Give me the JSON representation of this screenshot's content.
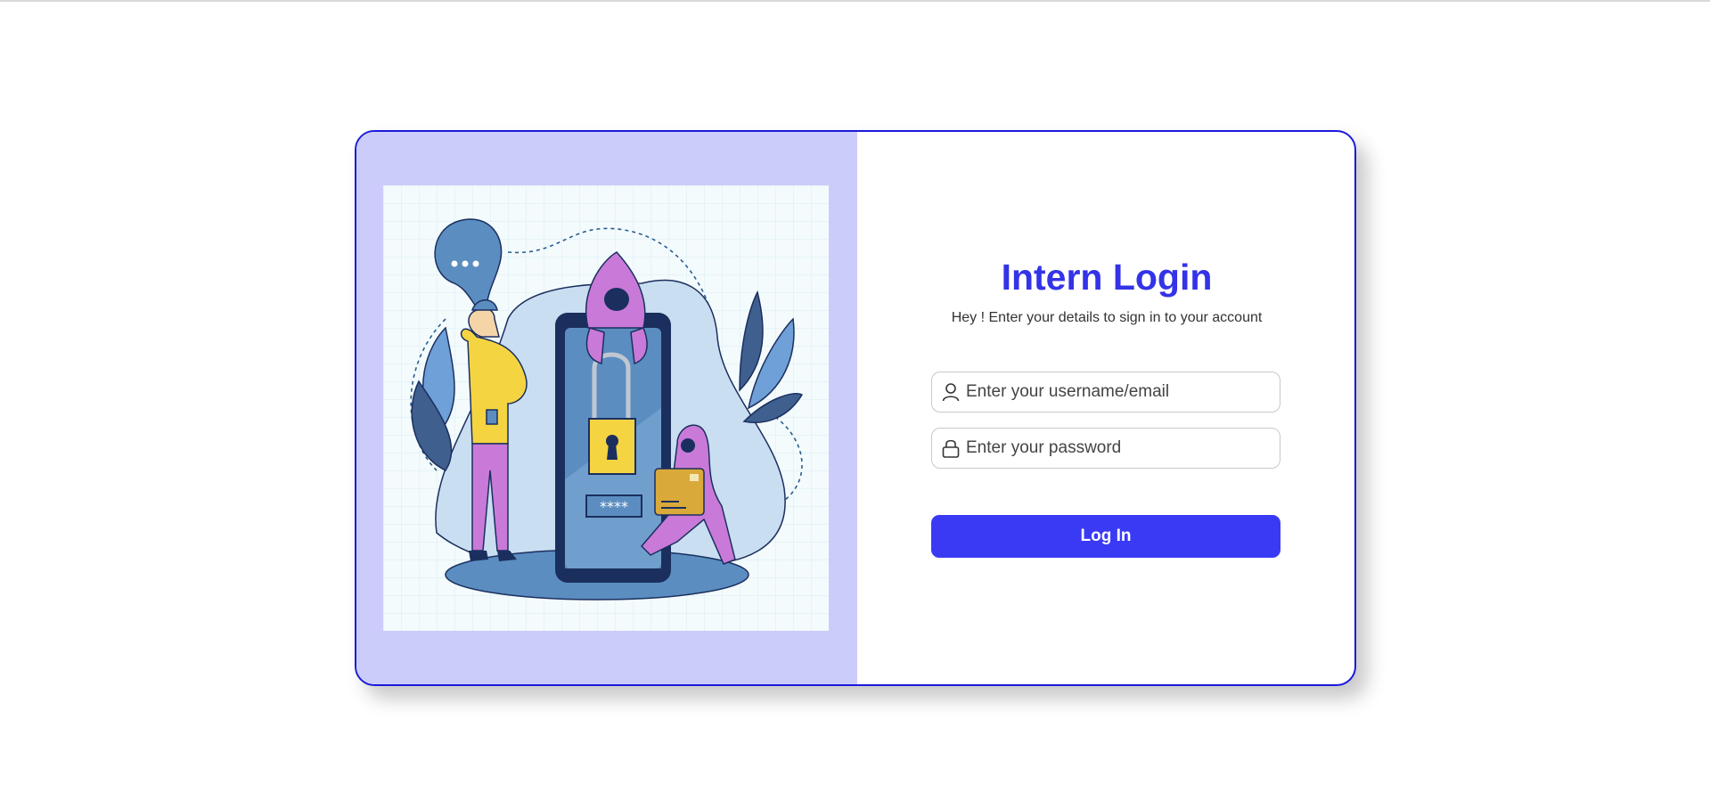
{
  "login": {
    "title": "Intern Login",
    "subtitle": "Hey ! Enter your details to sign in to your account",
    "username_placeholder": "Enter your username/email",
    "username_value": "",
    "password_placeholder": "Enter your password",
    "password_value": "",
    "login_button_label": "Log In"
  },
  "illustration": {
    "password_mask": "****",
    "icons": [
      "security-phone-illustration",
      "padlock-icon",
      "user-icon",
      "lock-icon"
    ]
  },
  "colors": {
    "accent": "#3a3af5",
    "title": "#3333e8",
    "card_border": "#1a1adb",
    "left_panel": "#ccccfa"
  }
}
